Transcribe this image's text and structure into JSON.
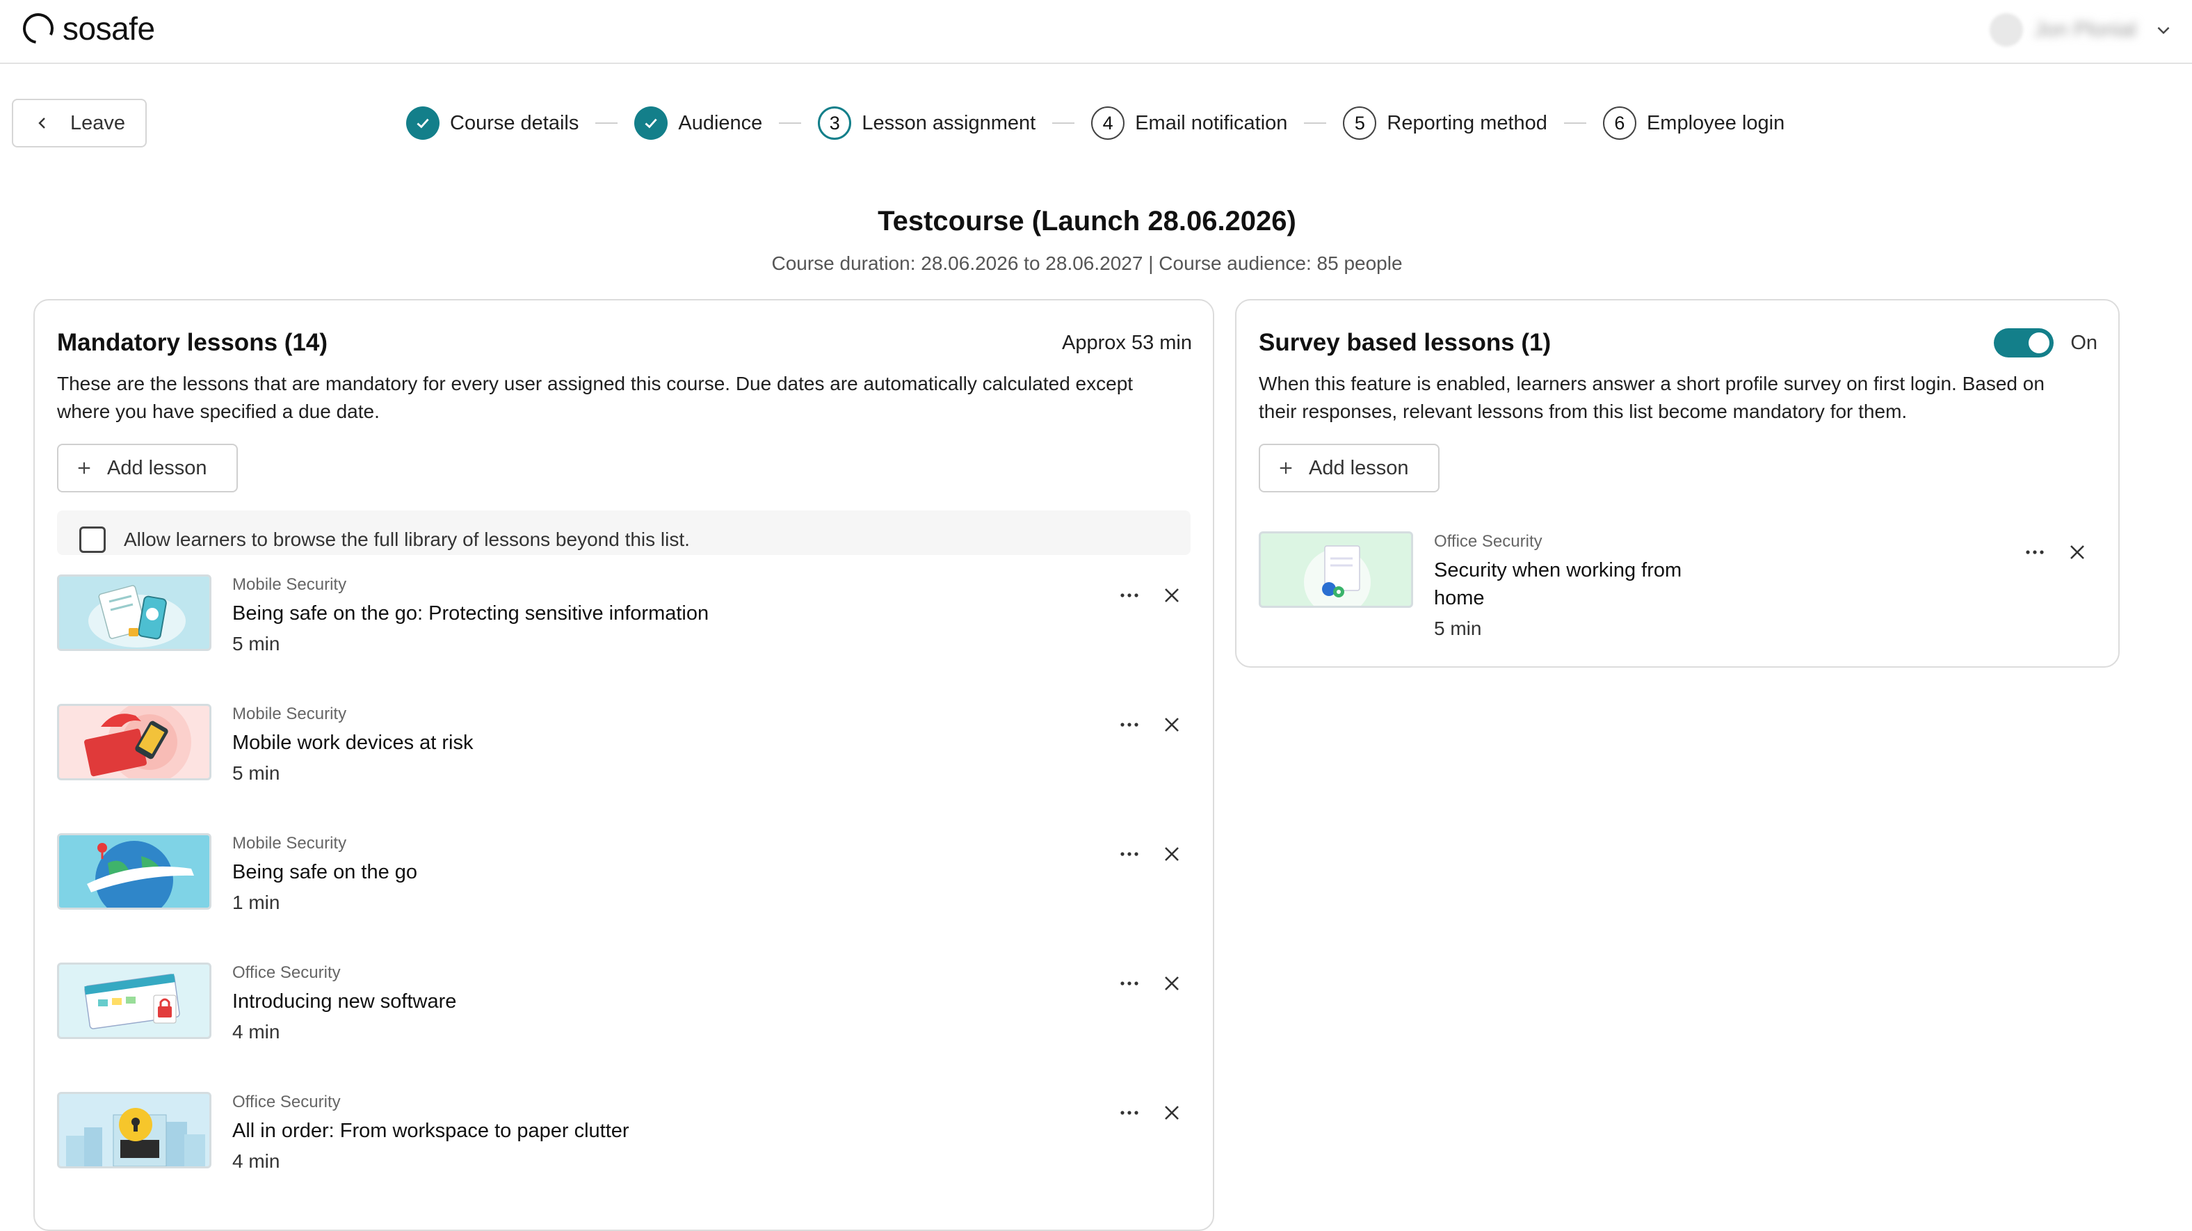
{
  "brand": {
    "name": "sosafe"
  },
  "user": {
    "name": "Jon Plonial"
  },
  "nav": {
    "leave_label": "Leave"
  },
  "steps": [
    {
      "number": "1",
      "label": "Course details",
      "state": "done"
    },
    {
      "number": "2",
      "label": "Audience",
      "state": "done"
    },
    {
      "number": "3",
      "label": "Lesson assignment",
      "state": "active"
    },
    {
      "number": "4",
      "label": "Email notification",
      "state": "todo"
    },
    {
      "number": "5",
      "label": "Reporting method",
      "state": "todo"
    },
    {
      "number": "6",
      "label": "Employee login",
      "state": "todo"
    }
  ],
  "course": {
    "title": "Testcourse (Launch 28.06.2026)",
    "subtitle": "Course duration: 28.06.2026 to 28.06.2027 | Course audience: 85 people"
  },
  "mandatory": {
    "title": "Mandatory lessons (14)",
    "approx": "Approx 53 min",
    "description": "These are the lessons that are mandatory for every user assigned this course. Due dates are automatically calculated except where you have specified a due date.",
    "add_label": "Add lesson",
    "browse_label": "Allow learners to browse the full library of lessons beyond this list.",
    "lessons": [
      {
        "category": "Mobile Security",
        "name": "Being safe on the go: Protecting sensitive information",
        "duration": "5 min"
      },
      {
        "category": "Mobile Security",
        "name": "Mobile work devices at risk",
        "duration": "5 min"
      },
      {
        "category": "Mobile Security",
        "name": "Being safe on the go",
        "duration": "1 min"
      },
      {
        "category": "Office Security",
        "name": "Introducing new software",
        "duration": "4 min"
      },
      {
        "category": "Office Security",
        "name": "All in order: From workspace to paper clutter",
        "duration": "4 min"
      }
    ]
  },
  "survey": {
    "title": "Survey based lessons (1)",
    "toggle_label": "On",
    "description": "When this feature is enabled, learners answer a short profile survey on first login. Based on their responses, relevant lessons from this list become mandatory for them.",
    "add_label": "Add lesson",
    "lessons": [
      {
        "category": "Office Security",
        "name_line1": "Security when working from",
        "name_line2": "home",
        "duration": "5 min"
      }
    ]
  },
  "colors": {
    "accent": "#137f8a",
    "border": "#dcdcdc"
  }
}
